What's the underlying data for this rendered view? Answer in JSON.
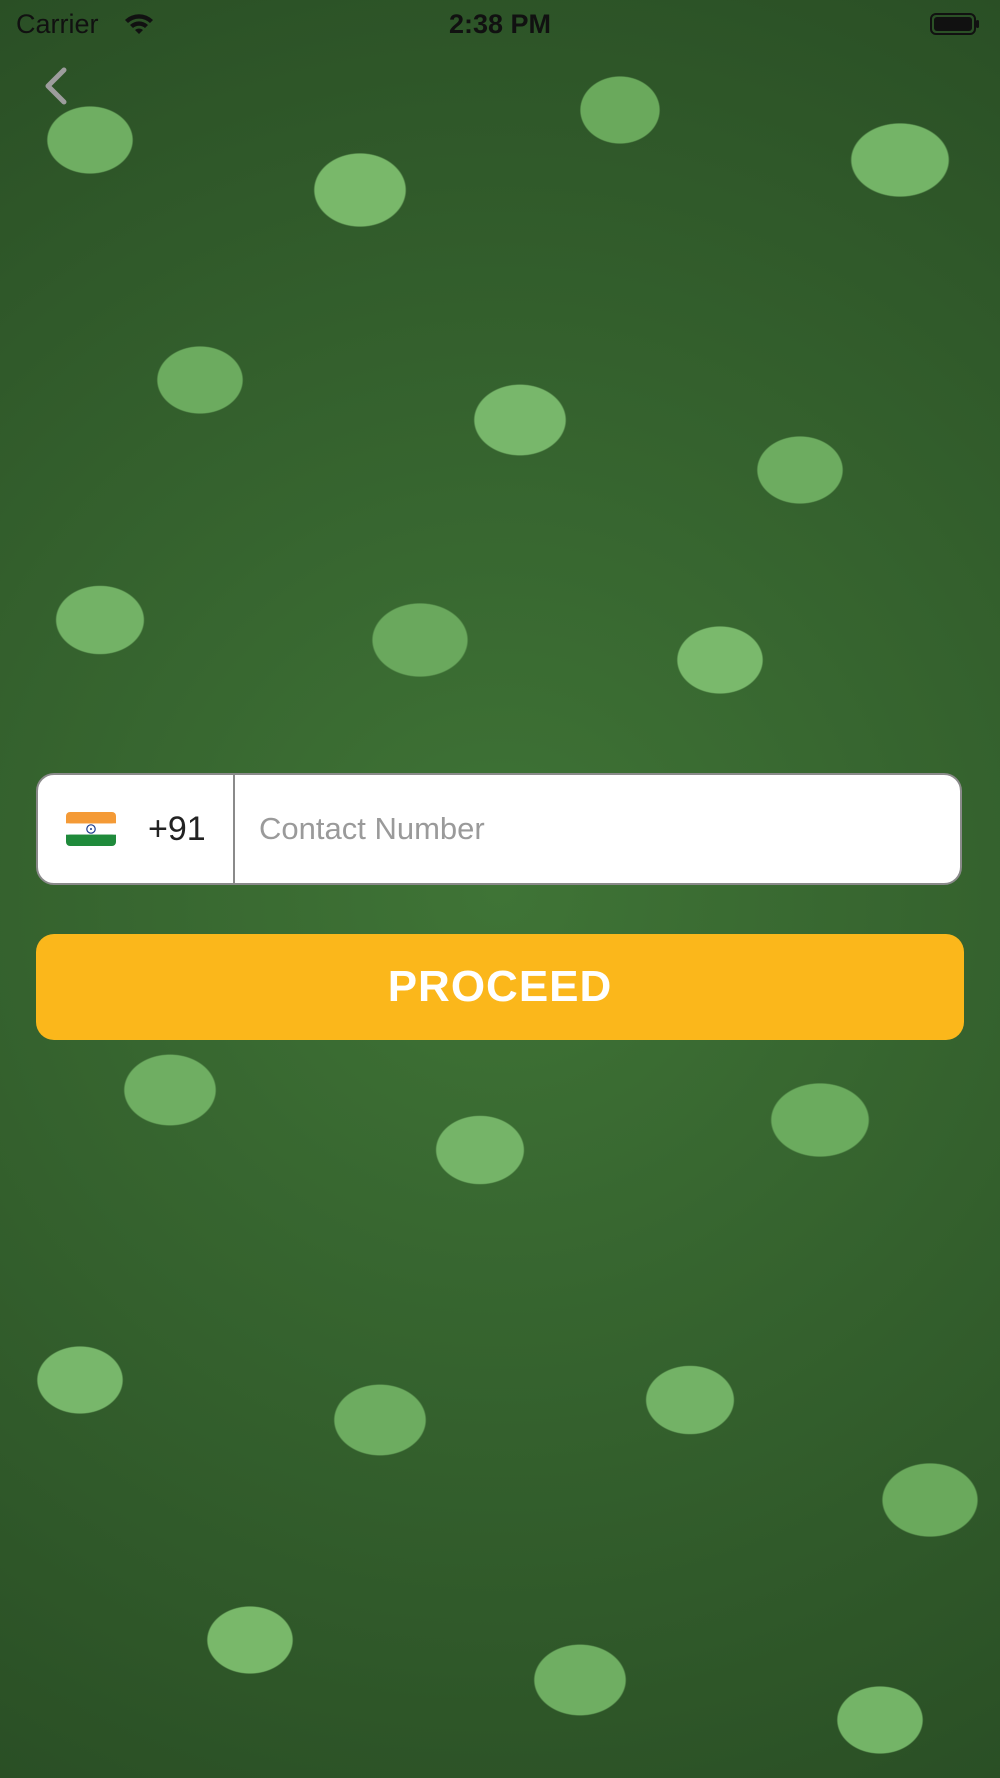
{
  "status_bar": {
    "carrier": "Carrier",
    "time": "2:38 PM"
  },
  "nav": {
    "back_icon": "chevron-left-icon"
  },
  "phone_input": {
    "country_flag": "india-flag-icon",
    "dial_code": "+91",
    "placeholder": "Contact Number",
    "value": ""
  },
  "actions": {
    "proceed_label": "PROCEED"
  },
  "colors": {
    "accent": "#fbb71b",
    "button_text": "#ffffff",
    "field_border": "#8a8a8a",
    "placeholder": "#9a9a9a"
  }
}
